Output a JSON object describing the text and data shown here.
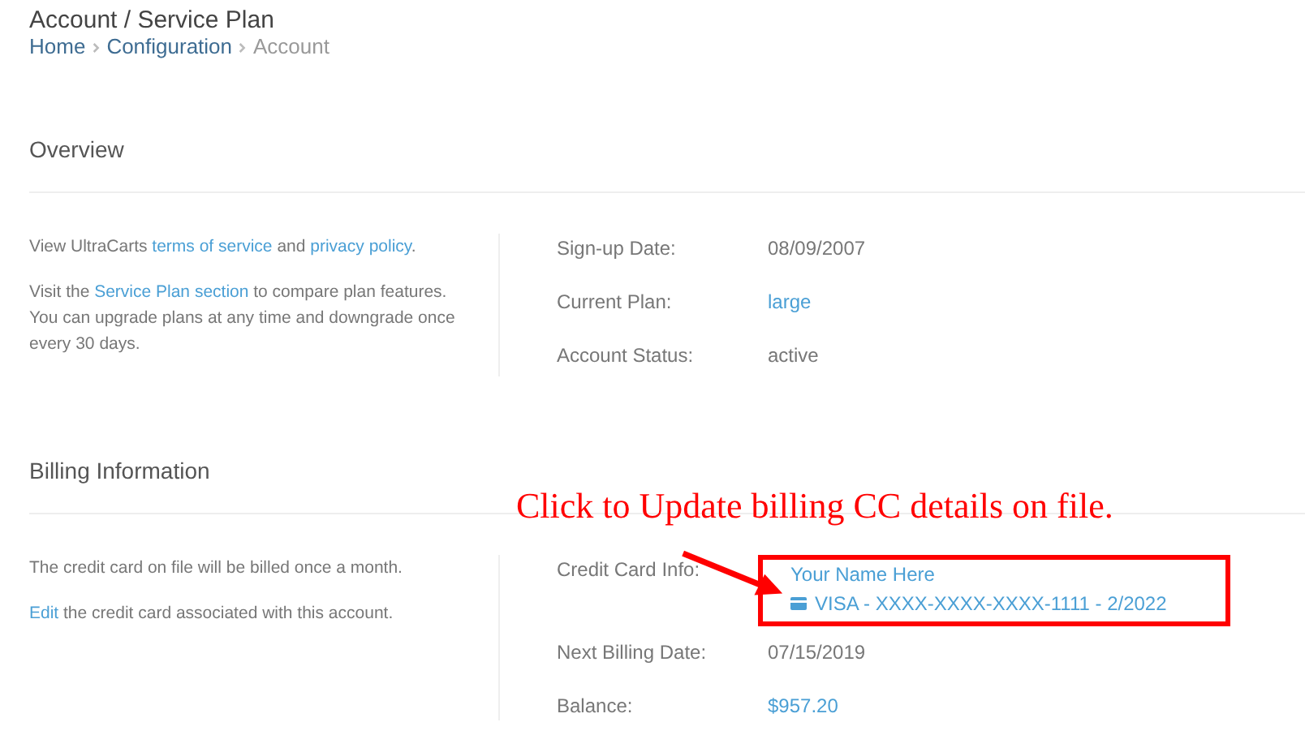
{
  "title": "Account / Service Plan",
  "breadcrumb": [
    {
      "label": "Home",
      "kind": "link"
    },
    {
      "label": "Configuration",
      "kind": "link"
    },
    {
      "label": "Account",
      "kind": "current"
    }
  ],
  "sections": [
    {
      "heading": "Overview",
      "paragraphs": [
        [
          {
            "text": "View UltraCarts ",
            "kind": "text"
          },
          {
            "text": "terms of service",
            "kind": "link"
          },
          {
            "text": " and ",
            "kind": "text"
          },
          {
            "text": "privacy policy",
            "kind": "link"
          },
          {
            "text": ".",
            "kind": "text"
          }
        ],
        [
          {
            "text": "Visit the ",
            "kind": "text"
          },
          {
            "text": "Service Plan section",
            "kind": "link"
          },
          {
            "text": " to compare plan features. You can upgrade plans at any time and downgrade once every 30 days.",
            "kind": "text"
          }
        ]
      ],
      "fields": [
        {
          "label": "Sign-up Date:",
          "kind": "text",
          "value": "08/09/2007"
        },
        {
          "label": "Current Plan:",
          "kind": "link",
          "value": "large"
        },
        {
          "label": "Account Status:",
          "kind": "text",
          "value": "active"
        }
      ]
    },
    {
      "heading": "Billing Information",
      "paragraphs": [
        [
          {
            "text": "The credit card on file will be billed once a month.",
            "kind": "text"
          }
        ],
        [
          {
            "text": "Edit",
            "kind": "link"
          },
          {
            "text": " the credit card associated with this account.",
            "kind": "text"
          }
        ]
      ],
      "fields": [
        {
          "label": "Credit Card Info:",
          "kind": "card",
          "value": "Your Name Here",
          "card": "VISA - XXXX-XXXX-XXXX-1111 - 2/2022"
        },
        {
          "label": "Next Billing Date:",
          "kind": "text",
          "value": "07/15/2019"
        },
        {
          "label": "Balance:",
          "kind": "link",
          "value": "$957.20"
        }
      ]
    }
  ],
  "annotation": {
    "text": "Click to Update billing CC details on file."
  }
}
